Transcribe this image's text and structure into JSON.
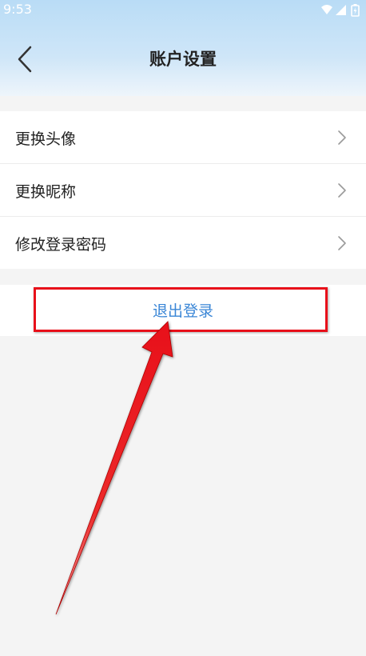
{
  "status_bar": {
    "time": "9:53"
  },
  "header": {
    "title": "账户设置",
    "back_icon": "chevron-left-icon"
  },
  "menu": {
    "items": [
      {
        "label": "更换头像",
        "icon": "chevron-right-icon"
      },
      {
        "label": "更换昵称",
        "icon": "chevron-right-icon"
      },
      {
        "label": "修改登录密码",
        "icon": "chevron-right-icon"
      }
    ]
  },
  "logout": {
    "label": "退出登录",
    "color": "#3a86d6"
  },
  "annotation": {
    "highlight_color": "#e8101a"
  }
}
